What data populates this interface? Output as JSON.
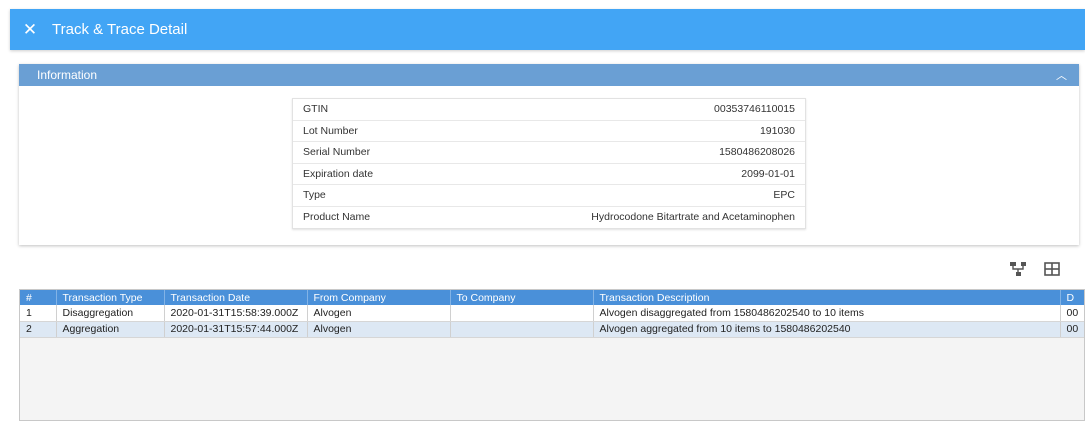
{
  "titlebar": {
    "title": "Track & Trace Detail",
    "close_icon": "close-icon"
  },
  "info_panel": {
    "header": "Information",
    "rows": [
      {
        "label": "GTIN",
        "value": "00353746110015"
      },
      {
        "label": "Lot Number",
        "value": "191030"
      },
      {
        "label": "Serial Number",
        "value": "1580486208026"
      },
      {
        "label": "Expiration date",
        "value": "2099-01-01"
      },
      {
        "label": "Type",
        "value": "EPC"
      },
      {
        "label": "Product Name",
        "value": "Hydrocodone Bitartrate and Acetaminophen"
      }
    ]
  },
  "toolbar": {
    "icons": [
      "hierarchy-icon",
      "grid-icon"
    ]
  },
  "grid": {
    "columns": [
      "#",
      "Transaction Type",
      "Transaction Date",
      "From Company",
      "To Company",
      "Transaction Description",
      "D"
    ],
    "rows": [
      [
        "1",
        "Disaggregation",
        "2020-01-31T15:58:39.000Z",
        "Alvogen",
        "",
        "Alvogen disaggregated from 1580486202540 to 10 items",
        "00"
      ],
      [
        "2",
        "Aggregation",
        "2020-01-31T15:57:44.000Z",
        "Alvogen",
        "",
        "Alvogen aggregated from 10 items to 1580486202540",
        "00"
      ]
    ]
  },
  "colors": {
    "titlebar": "#42a5f5",
    "panel_header": "#6a9fd4",
    "grid_header": "#4a90d9",
    "selected_row": "#dde8f4"
  }
}
